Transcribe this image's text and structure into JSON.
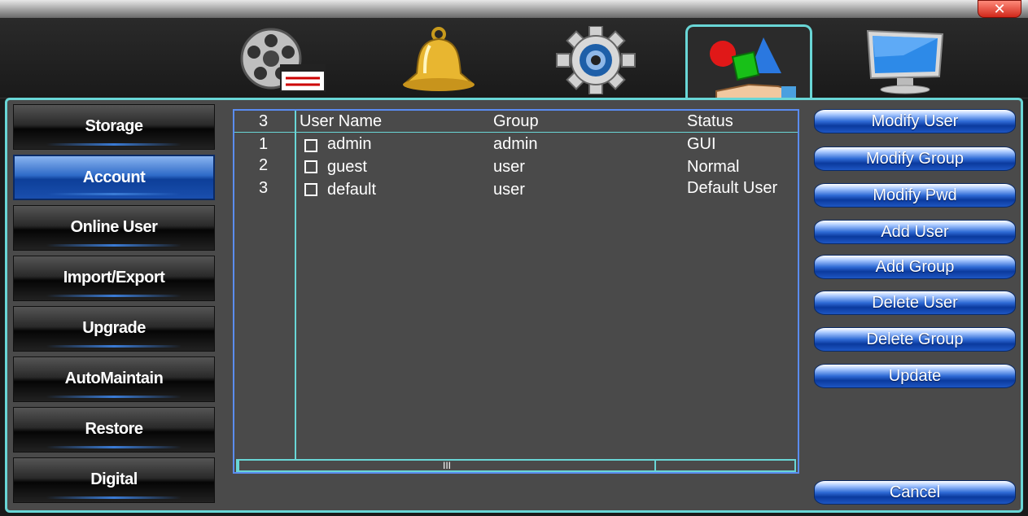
{
  "window": {
    "close_glyph": "✕"
  },
  "toolbar": {
    "tabs": [
      {
        "icon": "film-reel-icon"
      },
      {
        "icon": "bell-icon"
      },
      {
        "icon": "gear-icon"
      },
      {
        "icon": "shapes-hand-icon",
        "active": true
      },
      {
        "icon": "monitor-icon"
      }
    ]
  },
  "sidebar": {
    "items": [
      {
        "label": "Storage"
      },
      {
        "label": "Account",
        "active": true
      },
      {
        "label": "Online User"
      },
      {
        "label": "Import/Export"
      },
      {
        "label": "Upgrade"
      },
      {
        "label": "AutoMaintain"
      },
      {
        "label": "Restore"
      },
      {
        "label": "Digital"
      }
    ]
  },
  "table": {
    "count": "3",
    "headers": {
      "user_name": "User Name",
      "group": "Group",
      "status": "Status"
    },
    "rows": [
      {
        "num": "1",
        "user": "admin",
        "group": "admin",
        "status": "GUI"
      },
      {
        "num": "2",
        "user": "guest",
        "group": "user",
        "status": "Normal"
      },
      {
        "num": "3",
        "user": "default",
        "group": "user",
        "status": "Default User"
      }
    ],
    "scroll_thumb": "III"
  },
  "actions": {
    "modify_user": "Modify User",
    "modify_group": "Modify Group",
    "modify_pwd": "Modify Pwd",
    "add_user": "Add User",
    "add_group": "Add Group",
    "delete_user": "Delete User",
    "delete_group": "Delete Group",
    "update": "Update",
    "cancel": "Cancel"
  },
  "colors": {
    "accent_border": "#69d6d6",
    "button_blue": "#2f6bd6",
    "panel_bg": "#4a4a4a"
  }
}
